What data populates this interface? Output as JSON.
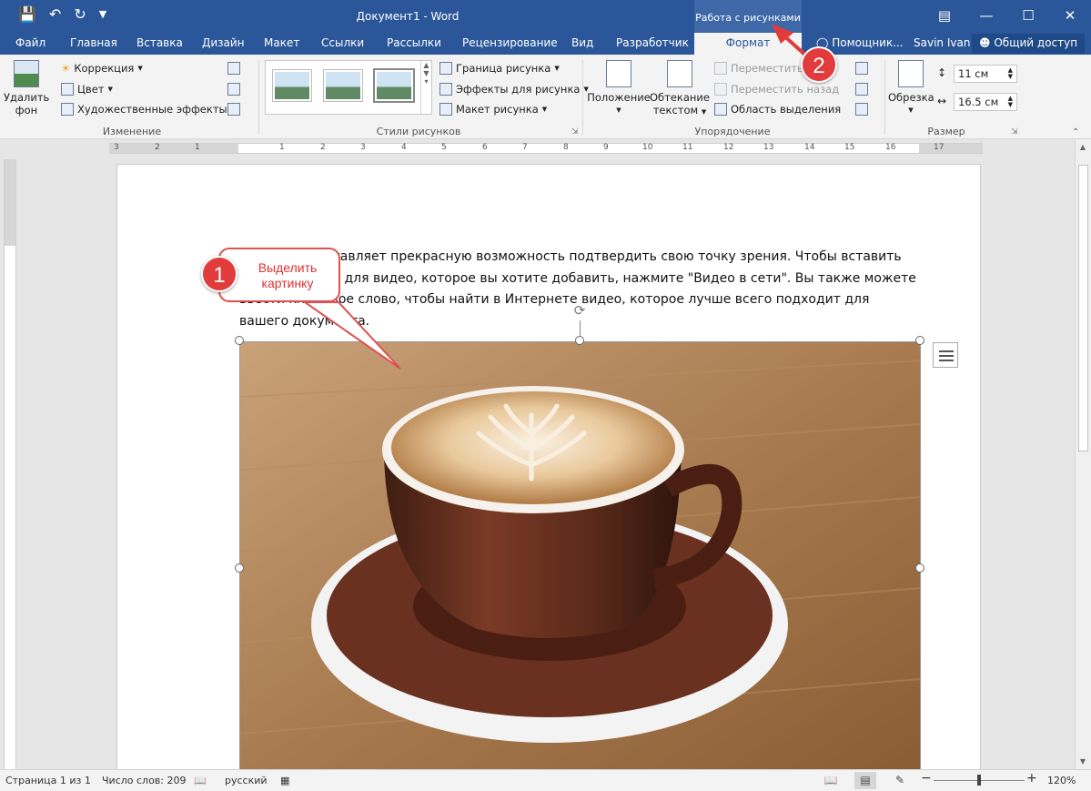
{
  "window": {
    "title": "Документ1 - Word",
    "context_group": "Работа с рисунками",
    "controls": [
      "ribbon-display-icon",
      "minimize-icon",
      "maximize-icon",
      "close-icon"
    ]
  },
  "tabs": [
    "Файл",
    "Главная",
    "Вставка",
    "Дизайн",
    "Макет",
    "Ссылки",
    "Рассылки",
    "Рецензирование",
    "Вид",
    "Разработчик",
    "Формат"
  ],
  "active_tab": "Формат",
  "help": "Помощник...",
  "user": "Savin Ivan",
  "share": "Общий доступ",
  "ribbon": {
    "change": {
      "remove_bg_1": "Удалить",
      "remove_bg_2": "фон",
      "correction": "Коррекция",
      "color": "Цвет",
      "artistic": "Художественные эффекты",
      "label": "Изменение"
    },
    "styles": {
      "border": "Граница рисунка",
      "effects": "Эффекты для рисунка",
      "layout": "Макет рисунка",
      "label": "Стили рисунков"
    },
    "arrange": {
      "position": "Положение",
      "wrap_1": "Обтекание",
      "wrap_2": "текстом",
      "forward": "Переместить в",
      "backward": "Переместить назад",
      "selection_pane": "Область выделения",
      "label": "Упорядочение"
    },
    "size": {
      "crop": "Обрезка",
      "height": "11 см",
      "width": "16.5 см",
      "label": "Размер"
    }
  },
  "ruler": {
    "h_numbers": [
      "3",
      "2",
      "1",
      "1",
      "2",
      "3",
      "4",
      "5",
      "6",
      "7",
      "8",
      "9",
      "10",
      "11",
      "12",
      "13",
      "14",
      "15",
      "16",
      "17"
    ]
  },
  "document": {
    "lines": [
      "Видео предоставляет прекрасную возможность подтвердить свою точку зрения. Чтобы вставить",
      "код внедрения для видео, которое вы хотите добавить, нажмите \"Видео в сети\". Вы также можете",
      "ввести ключевое слово, чтобы найти в Интернете видео, которое лучше всего подходит для",
      "вашего документа."
    ]
  },
  "annotations": {
    "step1_number": "1",
    "step1_text_1": "Выделить",
    "step1_text_2": "картинку",
    "step2_number": "2",
    "color": "#e23b3b"
  },
  "status": {
    "page": "Страница 1 из 1",
    "words": "Число слов: 209",
    "language": "русский",
    "zoom": "120%",
    "zoom_minus": "−",
    "zoom_plus": "+"
  }
}
